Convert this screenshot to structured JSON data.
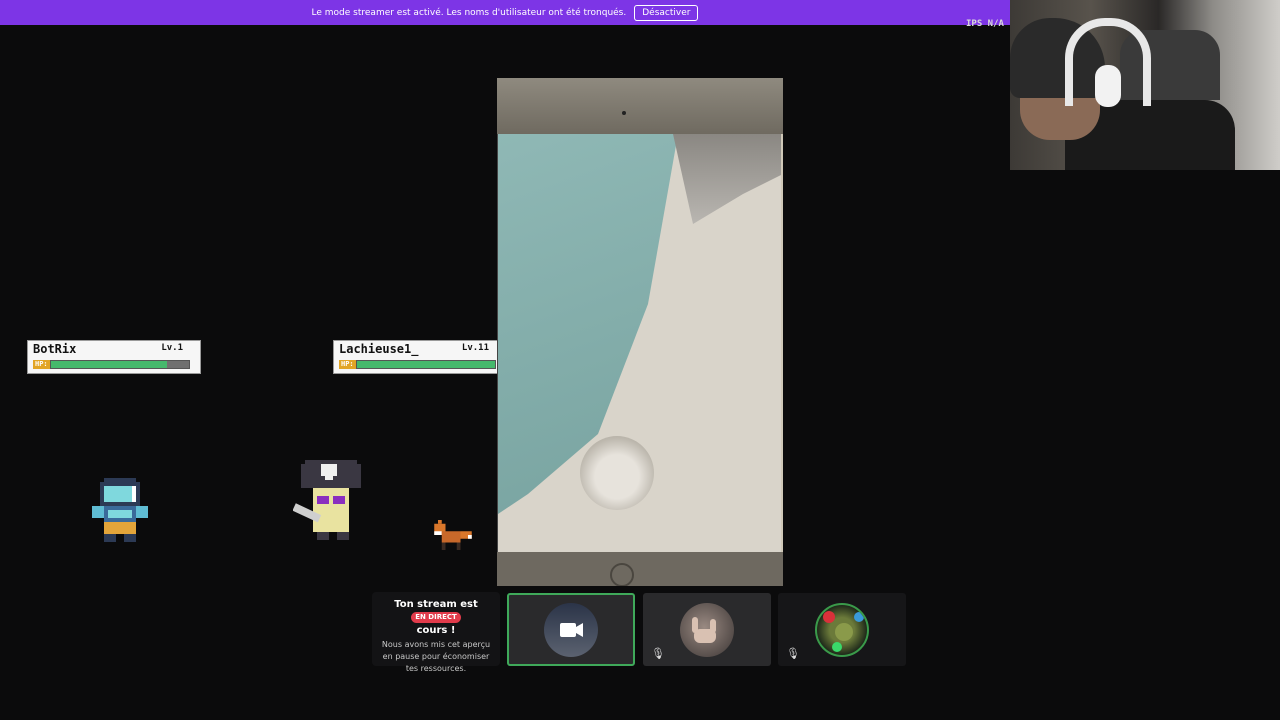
{
  "banner": {
    "message": "Le mode streamer est activé. Les noms d'utilisateur ont été tronqués.",
    "button_label": "Désactiver",
    "background": "#7d35e6"
  },
  "overlay": {
    "ips_text": "IPS N/A"
  },
  "game": {
    "players": [
      {
        "name": "BotRix",
        "level": "Lv.1",
        "hp_label": "HP:",
        "hp_fraction": 0.84
      },
      {
        "name": "Lachieuse1_",
        "level": "Lv.11",
        "hp_label": "HP:",
        "hp_fraction": 1.0
      }
    ]
  },
  "stream_notice": {
    "title_part1": "Ton stream est",
    "live_badge": "EN DIRECT",
    "title_part2": "cours !",
    "body": "Nous avons mis cet aperçu en pause pour économiser tes ressources."
  },
  "tiles": [
    {
      "name": "camera",
      "icon": "video-camera-icon",
      "selected": true
    },
    {
      "name": "participant",
      "icon": "avatar",
      "muted": true
    },
    {
      "name": "participant",
      "icon": "avatar",
      "muted": true
    }
  ],
  "colors": {
    "accent_green": "#3fa95a",
    "live_red": "#e13b4b",
    "hp_green": "#45b86c"
  }
}
